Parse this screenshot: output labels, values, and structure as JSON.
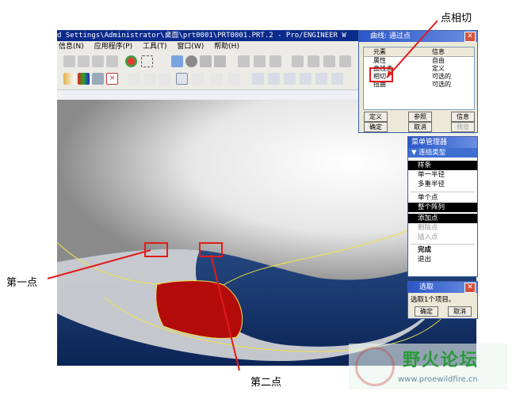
{
  "window": {
    "title": "d Settings\\Administrator\\桌面\\prt0001\\PRT0001.PRT.2 - Pro/ENGINEER W"
  },
  "menubar": [
    "信息(N)",
    "应用程序(P)",
    "工具(T)",
    "窗口(W)",
    "帮助(H)"
  ],
  "curve_dialog": {
    "title": "曲线: 通过点",
    "col_element": "元素",
    "col_info": "信息",
    "rows": [
      {
        "element": "属性",
        "info": "自由"
      },
      {
        "element": "曲线点",
        "info": "定义"
      },
      {
        "element": "相切",
        "info": "可选的"
      },
      {
        "element": "扭曲",
        "info": "可选的"
      }
    ],
    "buttons": [
      "定义",
      "参照",
      "信息",
      "确定",
      "取消",
      "预览"
    ]
  },
  "menu_manager": {
    "title": "菜单管理器",
    "section": "连结类型",
    "items": [
      {
        "label": "样条",
        "state": "selected"
      },
      {
        "label": "单一半径",
        "state": "normal"
      },
      {
        "label": "多重半径",
        "state": "normal"
      },
      {
        "label": "单个点",
        "state": "normal"
      },
      {
        "label": "整个阵列",
        "state": "selected"
      },
      {
        "label": "添加点",
        "state": "selected"
      },
      {
        "label": "删除点",
        "state": "disabled"
      },
      {
        "label": "插入点",
        "state": "disabled"
      },
      {
        "label": "完成",
        "state": "bold"
      },
      {
        "label": "退出",
        "state": "normal"
      }
    ]
  },
  "select_dialog": {
    "title": "选取",
    "message": "选取1个项目。",
    "ok": "确定",
    "cancel": "取消"
  },
  "annotations": {
    "tangent": "点相切",
    "first_point": "第一点",
    "second_point": "第二点"
  },
  "watermark": {
    "name": "野火论坛",
    "url": "www.proewildfire.cn"
  },
  "colors": {
    "title_blue": "#0a2a8c",
    "highlight_red": "#e21b1b",
    "surface_red": "#b30a0a",
    "dark_blue_bg": "#0e2a5c",
    "watermark_green": "#2a9a3a"
  }
}
